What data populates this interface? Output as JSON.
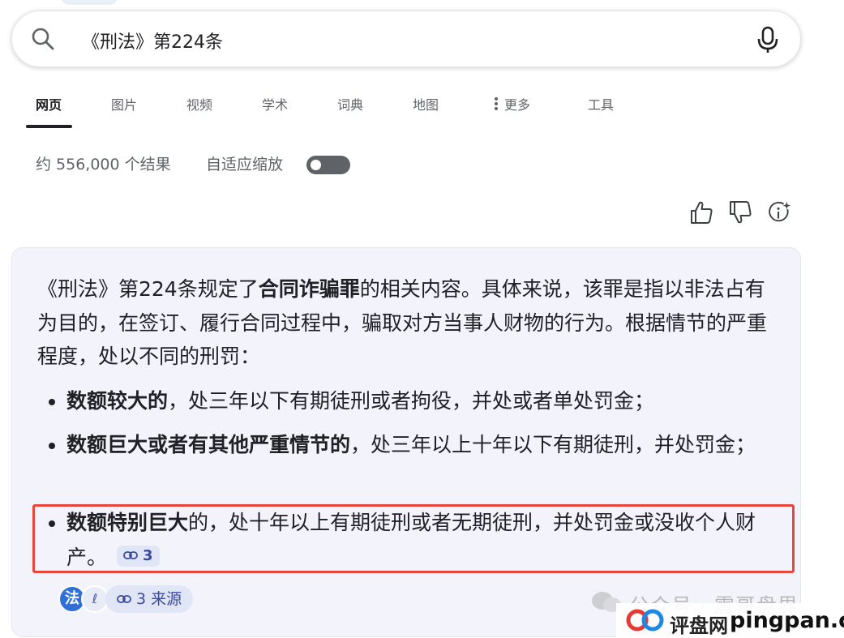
{
  "search": {
    "query": "《刑法》第224条"
  },
  "tabs": [
    {
      "label": "网页"
    },
    {
      "label": "图片"
    },
    {
      "label": "视频"
    },
    {
      "label": "学术"
    },
    {
      "label": "词典"
    },
    {
      "label": "地图"
    },
    {
      "label": "更多"
    },
    {
      "label": "工具"
    }
  ],
  "results": {
    "count_text": "约 556,000 个结果",
    "adaptive_zoom_label": "自适应缩放"
  },
  "answer": {
    "intro_prefix": "《刑法》第224条规定了",
    "intro_bold": "合同诈骗罪",
    "intro_suffix": "的相关内容。具体来说，该罪是指以非法占有为目的，在签订、履行合同过程中，骗取对方当事人财物的行为。根据情节的严重程度，处以不同的刑罚：",
    "bullets": [
      {
        "bold": "数额较大的",
        "text": "，处三年以下有期徒刑或者拘役，并处或者单处罚金；"
      },
      {
        "bold": "数额巨大或者有其他严重情节的",
        "text": "，处三年以上十年以下有期徒刑，并处罚金；"
      },
      {
        "bold": "数额特别巨大",
        "text": "的，处十年以上有期徒刑或者无期徒刑，并处罚金或没收个人财产。",
        "citation": "3"
      }
    ]
  },
  "sources": {
    "icon1": "法",
    "icon2": "ℓ",
    "label": "3 来源"
  },
  "watermark": {
    "wechat": "公众号 · 震哥盘界",
    "site_cn": "评盘网",
    "site_en": "pingpan.cc"
  },
  "colors": {
    "highlight": "#e8453c",
    "chip_bg": "#e1e6f7",
    "chip_text": "#3b4a9c",
    "card_bg": "#f3f4fb"
  },
  "icons": [
    "search-icon",
    "microphone-icon",
    "thumbs-up-icon",
    "thumbs-down-icon",
    "sparkle-info-icon",
    "link-icon",
    "wechat-icon"
  ]
}
